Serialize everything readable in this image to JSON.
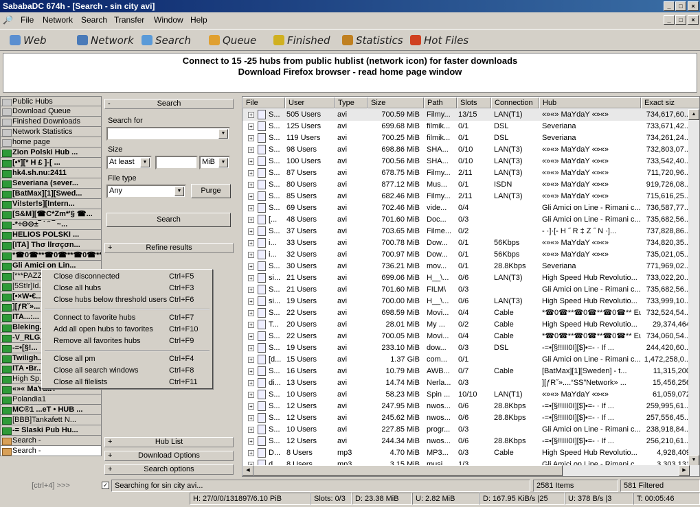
{
  "window": {
    "title": "SababaDC 674h - [Search - sin city avi]"
  },
  "menu": [
    "File",
    "Network",
    "Search",
    "Transfer",
    "Window",
    "Help"
  ],
  "toolbar": [
    "Web",
    "Network",
    "Search",
    "Queue",
    "Finished",
    "Statistics",
    "Hot Files"
  ],
  "banner": {
    "line1": "Connect to 15 -25 hubs from public hublist (network icon) for faster downloads",
    "line2": "Download Firefox browser - read home page window"
  },
  "hubs": [
    {
      "name": "Public Hubs",
      "t": "n"
    },
    {
      "name": "Download Queue",
      "t": "n"
    },
    {
      "name": "Finished Downloads",
      "t": "n"
    },
    {
      "name": "Network Statistics",
      "t": "n"
    },
    {
      "name": "home page",
      "t": "n"
    },
    {
      "name": "Zion Polski Hub ...",
      "t": "b"
    },
    {
      "name": "[•*][* H £ ]-[ ...",
      "t": "b"
    },
    {
      "name": "hk4.sh.nu:2411",
      "t": "b"
    },
    {
      "name": "Severiana (sever...",
      "t": "b"
    },
    {
      "name": "[BatMax][1][Swed...",
      "t": "b"
    },
    {
      "name": "Vi!ster!s][Intern...",
      "t": "b"
    },
    {
      "name": "[S&M][☎C*Zm*'§ ☎...",
      "t": "b"
    },
    {
      "name": "-*÷Θ⊙±‾ ˙ ˝ ‾ ~...",
      "t": "b"
    },
    {
      "name": "HELIOS POLSKI ...",
      "t": "b"
    },
    {
      "name": "[ITA] Thσ llrσçσn...",
      "t": "b"
    },
    {
      "name": "*☎0☎**☎0☎**☎0☎**...",
      "t": "b"
    },
    {
      "name": "Gli Amici on Lin...",
      "t": "b"
    },
    {
      "name": "[***PAZZ...",
      "t": "a"
    },
    {
      "name": "[5St!r]Id...",
      "t": "a"
    },
    {
      "name": "[•×W•€...",
      "t": "b"
    },
    {
      "name": "][ƒR˝»...",
      "t": "b"
    },
    {
      "name": "ITA...:...",
      "t": "b"
    },
    {
      "name": "Bleking...",
      "t": "b"
    },
    {
      "name": "-V_RLG...",
      "t": "b"
    },
    {
      "name": "-=•[§!...",
      "t": "b"
    },
    {
      "name": "Twiligh...",
      "t": "b"
    },
    {
      "name": "ITA •Br...",
      "t": "b"
    },
    {
      "name": "High Sp...",
      "t": "a"
    },
    {
      "name": "«»« MaYdaY",
      "t": "b"
    },
    {
      "name": "Polandia1",
      "t": "a"
    },
    {
      "name": "MC®1 ...eT • HUB ...",
      "t": "b"
    },
    {
      "name": "[BBB]Tankafett N...",
      "t": "a"
    },
    {
      "name": "-= Slaski Pub Hu...",
      "t": "b"
    },
    {
      "name": "Search -",
      "t": "s"
    },
    {
      "name": "Search -",
      "t": "sel"
    }
  ],
  "hubfoot": "[ctrl+4] >>>",
  "search": {
    "header": "Search",
    "search_for_label": "Search for",
    "search_value": "",
    "size_label": "Size",
    "size_mode": "At least",
    "size_value": "",
    "size_unit": "MiB",
    "filetype_label": "File type",
    "filetype": "Any",
    "purge": "Purge",
    "search_btn": "Search",
    "refine": "Refine results",
    "hub_list": "Hub List",
    "download_options": "Download Options",
    "search_options": "Search options",
    "only_free_label": "Searching for sin city avi..."
  },
  "columns": [
    "File",
    "User",
    "Type",
    "Size",
    "Path",
    "Slots",
    "Connection",
    "Hub",
    "Exact siz"
  ],
  "rows": [
    [
      "S...",
      "505 Users",
      "avi",
      "700.59 MiB",
      "Filmy...",
      "13/15",
      "LAN(T1)",
      "«»«» MaYdaY «»«»",
      "734,617,60..."
    ],
    [
      "S...",
      "125 Users",
      "avi",
      "699.68 MiB",
      "filmik...",
      "0/1",
      "DSL",
      "Severiana",
      "733,671,42..."
    ],
    [
      "S...",
      "119 Users",
      "avi",
      "700.25 MiB",
      "filmik...",
      "0/1",
      "DSL",
      "Severiana",
      "734,261,24..."
    ],
    [
      "S...",
      "98 Users",
      "avi",
      "698.86 MiB",
      "SHA...",
      "0/10",
      "LAN(T3)",
      "«»«» MaYdaY «»«»",
      "732,803,07..."
    ],
    [
      "S...",
      "100 Users",
      "avi",
      "700.56 MiB",
      "SHA...",
      "0/10",
      "LAN(T3)",
      "«»«» MaYdaY «»«»",
      "733,542,40..."
    ],
    [
      "S...",
      "87 Users",
      "avi",
      "678.75 MiB",
      "Filmy...",
      "2/11",
      "LAN(T3)",
      "«»«» MaYdaY «»«»",
      "711,720,96..."
    ],
    [
      "S...",
      "80 Users",
      "avi",
      "877.12 MiB",
      "Mus...",
      "0/1",
      "ISDN",
      "«»«» MaYdaY «»«»",
      "919,726,08..."
    ],
    [
      "S...",
      "85 Users",
      "avi",
      "682.46 MiB",
      "Filmy...",
      "2/11",
      "LAN(T3)",
      "«»«» MaYdaY «»«»",
      "715,616,25..."
    ],
    [
      "S...",
      "69 Users",
      "avi",
      "702.46 MiB",
      "vide...",
      "0/4",
      "",
      "Gli Amici on Line - Rimani c...",
      "736,587,77..."
    ],
    [
      "[...",
      "48 Users",
      "avi",
      "701.60 MiB",
      "Doc...",
      "0/3",
      "",
      "Gli Amici on Line - Rimani c...",
      "735,682,56..."
    ],
    [
      "S...",
      "37 Users",
      "avi",
      "703.65 MiB",
      "Filme...",
      "0/2",
      "",
      "- ·]·[- H ˝ R ‡ Z ˝ N ·]...",
      "737,828,86..."
    ],
    [
      "i...",
      "33 Users",
      "avi",
      "700.78 MiB",
      "Dow...",
      "0/1",
      "56Kbps",
      "«»«» MaYdaY «»«»",
      "734,820,35..."
    ],
    [
      "i...",
      "32 Users",
      "avi",
      "700.97 MiB",
      "Dow...",
      "0/1",
      "56Kbps",
      "«»«» MaYdaY «»«»",
      "735,021,05..."
    ],
    [
      "S...",
      "30 Users",
      "avi",
      "736.21 MiB",
      "mov...",
      "0/1",
      "28.8Kbps",
      "Severiana",
      "771,969,02..."
    ],
    [
      "si...",
      "21 Users",
      "avi",
      "699.06 MiB",
      "H__\\...",
      "0/6",
      "LAN(T3)",
      "High Speed Hub Revolutio...",
      "733,022,20..."
    ],
    [
      "S...",
      "21 Users",
      "avi",
      "701.60 MiB",
      "FILM\\",
      "0/3",
      "",
      "Gli Amici on Line - Rimani c...",
      "735,682,56..."
    ],
    [
      "si...",
      "19 Users",
      "avi",
      "700.00 MiB",
      "H__\\...",
      "0/6",
      "LAN(T3)",
      "High Speed Hub Revolutio...",
      "733,999,10..."
    ],
    [
      "S...",
      "22 Users",
      "avi",
      "698.59 MiB",
      "Movi...",
      "0/4",
      "Cable",
      "*☎0☎**☎0☎**☎0☎** Euro...",
      "732,524,54..."
    ],
    [
      "T...",
      "20 Users",
      "avi",
      "28.01 MiB",
      "My ...",
      "0/2",
      "Cable",
      "High Speed Hub Revolutio...",
      "29,374,464"
    ],
    [
      "S...",
      "22 Users",
      "avi",
      "700.05 MiB",
      "Movi...",
      "0/4",
      "Cable",
      "*☎0☎**☎0☎**☎0☎** Euro...",
      "734,060,54..."
    ],
    [
      "S...",
      "19 Users",
      "avi",
      "233.10 MiB",
      "dow...",
      "0/3",
      "DSL",
      "-=•[§!!ΙΙΙ0Ι][$]•=- · If ...",
      "244,420,60..."
    ],
    [
      "[d...",
      "15 Users",
      "avi",
      "1.37 GiB",
      "com...",
      "0/1",
      "",
      "Gli Amici on Line - Rimani c...",
      "1,472,258,0..."
    ],
    [
      "S...",
      "16 Users",
      "avi",
      "10.79 MiB",
      "AWB...",
      "0/7",
      "Cable",
      "[BatMax][1][Sweden] - t...",
      "11,315,200"
    ],
    [
      "di...",
      "13 Users",
      "avi",
      "14.74 MiB",
      "Nerla...",
      "0/3",
      "",
      "][ƒR˝»....“SS”Network» ...",
      "15,456,256"
    ],
    [
      "S...",
      "10 Users",
      "avi",
      "58.23 MiB",
      "Spin ...",
      "10/10",
      "LAN(T1)",
      "«»«» MaYdaY «»«»",
      "61,059,072"
    ],
    [
      "S...",
      "12 Users",
      "avi",
      "247.95 MiB",
      "nwos...",
      "0/6",
      "28.8Kbps",
      "-=•[§!!ΙΙΙ0Ι][$]•=- · If ...",
      "259,995,61..."
    ],
    [
      "S...",
      "12 Users",
      "avi",
      "245.62 MiB",
      "nwos...",
      "0/6",
      "28.8Kbps",
      "-=•[§!!ΙΙΙ0Ι][$]•=- · If ...",
      "257,556,45..."
    ],
    [
      "S...",
      "10 Users",
      "avi",
      "227.85 MiB",
      "progr...",
      "0/3",
      "",
      "Gli Amici on Line - Rimani c...",
      "238,918,84..."
    ],
    [
      "S...",
      "12 Users",
      "avi",
      "244.34 MiB",
      "nwos...",
      "0/6",
      "28.8Kbps",
      "-=•[§!!ΙΙΙ0Ι][$]•=- · If ...",
      "256,210,61..."
    ],
    [
      "D...",
      "8 Users",
      "mp3",
      "4.70 MiB",
      "MP3...",
      "0/3",
      "Cable",
      "High Speed Hub Revolutio...",
      "4,928,409"
    ],
    [
      "d...",
      "8 Users",
      "mp3",
      "3.15 MiB",
      "musi...",
      "1/3",
      "",
      "Gli Amici on Line - Rimani c...",
      "3,303,131"
    ]
  ],
  "context_menu": [
    {
      "label": "Close disconnected",
      "sc": "Ctrl+F5"
    },
    {
      "label": "Close all hubs",
      "sc": "Ctrl+F3"
    },
    {
      "label": "Close hubs below threshold users",
      "sc": "Ctrl+F6"
    },
    {
      "sep": true
    },
    {
      "label": "Connect to favorite hubs",
      "sc": "Ctrl+F7"
    },
    {
      "label": "Add all open hubs to favorites",
      "sc": "Ctrl+F10"
    },
    {
      "label": "Remove all favorites hubs",
      "sc": "Ctrl+F9"
    },
    {
      "sep": true
    },
    {
      "label": "Close all pm",
      "sc": "Ctrl+F4"
    },
    {
      "label": "Close all search windows",
      "sc": "Ctrl+F8"
    },
    {
      "label": "Close all filelists",
      "sc": "Ctrl+F11"
    }
  ],
  "status": {
    "items": "2581 Items",
    "filtered": "581 Filtered",
    "hubs": "H: 27/0/0/131897/6.10 PiB",
    "slots": "Slots: 0/3",
    "down": "D: 23.38 MiB",
    "up": "U: 2.82 MiB",
    "dspeed": "D: 167.95 KiB/s |25",
    "uspeed": "U: 378 B/s |3",
    "time": "T: 00:05:46"
  }
}
